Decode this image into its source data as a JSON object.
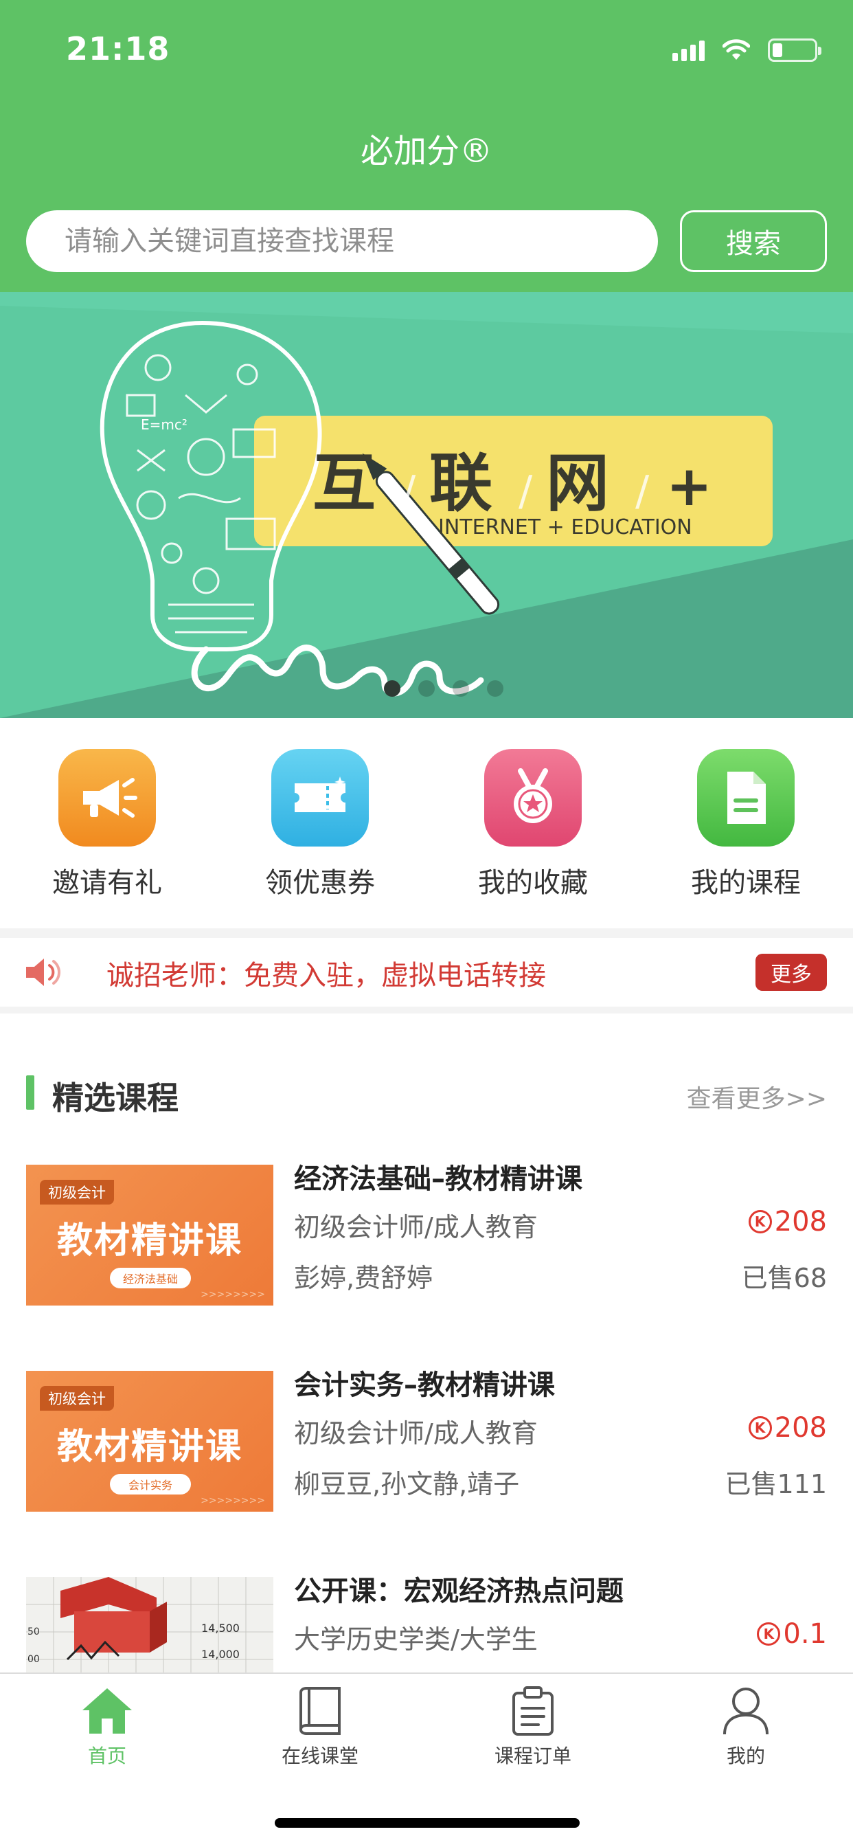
{
  "status_bar": {
    "time": "21:18"
  },
  "header": {
    "app_title": "必加分®",
    "search_placeholder": "请输入关键词直接查找课程",
    "search_button": "搜索"
  },
  "banner": {
    "headline_chars": [
      "互",
      "联",
      "网",
      "+"
    ],
    "subtitle": "INTERNET + EDUCATION",
    "art_word": "idea",
    "dots_count": 4,
    "active_dot": 1
  },
  "quick_menu": [
    {
      "label": "邀请有礼",
      "icon": "megaphone-icon",
      "color": "#f5a12a"
    },
    {
      "label": "领优惠券",
      "icon": "ticket-icon",
      "color": "#3bbde8"
    },
    {
      "label": "我的收藏",
      "icon": "medal-icon",
      "color": "#e8577a"
    },
    {
      "label": "我的课程",
      "icon": "document-icon",
      "color": "#5ec25a"
    }
  ],
  "notice": {
    "text": "诚招老师：免费入驻，虚拟电话转接",
    "more_label": "更多"
  },
  "section": {
    "title": "精选课程",
    "more_label": "查看更多>>"
  },
  "courses": [
    {
      "title": "经济法基础–教材精讲课",
      "category": "初级会计师/成人教育",
      "price": "208",
      "teachers": "彭婷,费舒婷",
      "sold": "已售68",
      "thumb_tag": "初级会计",
      "thumb_main": "教材精讲课",
      "thumb_sub": "经济法基础"
    },
    {
      "title": "会计实务–教材精讲课",
      "category": "初级会计师/成人教育",
      "price": "208",
      "teachers": "柳豆豆,孙文静,靖子",
      "sold": "已售111",
      "thumb_tag": "初级会计",
      "thumb_main": "教材精讲课",
      "thumb_sub": "会计实务"
    },
    {
      "title": "公开课：宏观经济热点问题",
      "category": "大学历史学类/大学生",
      "price": "0.1",
      "thumb_numbers": [
        "14,500",
        "14,000",
        "50",
        "00"
      ]
    }
  ],
  "tabbar": [
    {
      "label": "首页",
      "icon": "home-icon",
      "active": true
    },
    {
      "label": "在线课堂",
      "icon": "book-icon",
      "active": false
    },
    {
      "label": "课程订单",
      "icon": "clipboard-icon",
      "active": false
    },
    {
      "label": "我的",
      "icon": "person-icon",
      "active": false
    }
  ],
  "colors": {
    "brand_green": "#5ec265",
    "price_red": "#e0382f",
    "notice_red": "#d23a34"
  }
}
